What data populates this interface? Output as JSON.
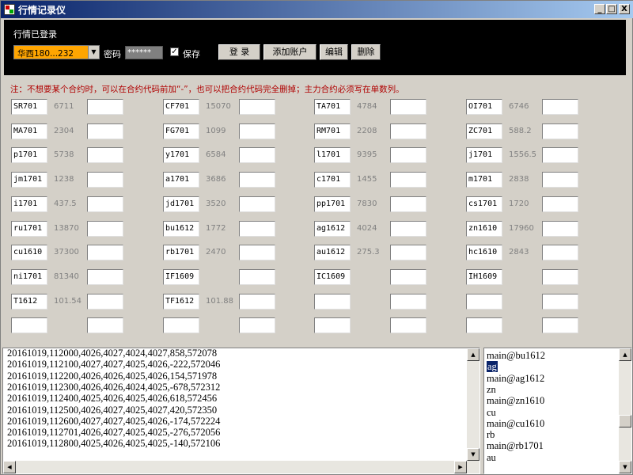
{
  "window": {
    "title": "行情记录仪",
    "controls": {
      "minimize": "_",
      "maximize": "□",
      "close": "X"
    }
  },
  "header": {
    "status": "行情已登录",
    "account": "华西180...232",
    "account_arrow": "▼",
    "password_label": "密码",
    "password_value": "******",
    "save_checked": "✓",
    "save_label": "保存",
    "login_button": "登 录",
    "add_account_button": "添加账户",
    "edit_button": "编辑",
    "delete_button": "删除"
  },
  "note": "注：不想要某个合约时，可以在合约代码前加“-”，也可以把合约代码完全删掉；主力合约必须写在单数列。",
  "contracts": [
    [
      {
        "code": "SR701",
        "price": "6711"
      },
      {
        "code": "CF701",
        "price": "15070"
      },
      {
        "code": "TA701",
        "price": "4784"
      },
      {
        "code": "OI701",
        "price": "6746"
      }
    ],
    [
      {
        "code": "MA701",
        "price": "2304"
      },
      {
        "code": "FG701",
        "price": "1099"
      },
      {
        "code": "RM701",
        "price": "2208"
      },
      {
        "code": "ZC701",
        "price": "588.2"
      }
    ],
    [
      {
        "code": "p1701",
        "price": "5738"
      },
      {
        "code": "y1701",
        "price": "6584"
      },
      {
        "code": "l1701",
        "price": "9395"
      },
      {
        "code": "j1701",
        "price": "1556.5"
      }
    ],
    [
      {
        "code": "jm1701",
        "price": "1238"
      },
      {
        "code": "a1701",
        "price": "3686"
      },
      {
        "code": "c1701",
        "price": "1455"
      },
      {
        "code": "m1701",
        "price": "2838"
      }
    ],
    [
      {
        "code": "i1701",
        "price": "437.5"
      },
      {
        "code": "jd1701",
        "price": "3520"
      },
      {
        "code": "pp1701",
        "price": "7830"
      },
      {
        "code": "cs1701",
        "price": "1720"
      }
    ],
    [
      {
        "code": "ru1701",
        "price": "13870"
      },
      {
        "code": "bu1612",
        "price": "1772"
      },
      {
        "code": "ag1612",
        "price": "4024"
      },
      {
        "code": "zn1610",
        "price": "17960"
      }
    ],
    [
      {
        "code": "cu1610",
        "price": "37300"
      },
      {
        "code": "rb1701",
        "price": "2470"
      },
      {
        "code": "au1612",
        "price": "275.3"
      },
      {
        "code": "hc1610",
        "price": "2843"
      }
    ],
    [
      {
        "code": "ni1701",
        "price": "81340"
      },
      {
        "code": "IF1609",
        "price": ""
      },
      {
        "code": "IC1609",
        "price": ""
      },
      {
        "code": "IH1609",
        "price": ""
      }
    ],
    [
      {
        "code": "T1612",
        "price": "101.54"
      },
      {
        "code": "TF1612",
        "price": "101.88"
      },
      {
        "code": "",
        "price": ""
      },
      {
        "code": "",
        "price": ""
      }
    ],
    [
      {
        "code": "",
        "price": ""
      },
      {
        "code": "",
        "price": ""
      },
      {
        "code": "",
        "price": ""
      },
      {
        "code": "",
        "price": ""
      }
    ]
  ],
  "log": [
    "20161019,112000,4026,4027,4024,4027,858,572078",
    "20161019,112100,4027,4027,4025,4026,-222,572046",
    "20161019,112200,4026,4026,4025,4026,154,571978",
    "20161019,112300,4026,4026,4024,4025,-678,572312",
    "20161019,112400,4025,4026,4025,4026,618,572456",
    "20161019,112500,4026,4027,4025,4027,420,572350",
    "20161019,112600,4027,4027,4025,4026,-174,572224",
    "20161019,112701,4026,4027,4025,4025,-276,572056",
    "20161019,112800,4025,4026,4025,4025,-140,572106"
  ],
  "side_log": [
    {
      "text": "main@bu1612",
      "selected": false
    },
    {
      "text": "ag",
      "selected": true
    },
    {
      "text": "main@ag1612",
      "selected": false
    },
    {
      "text": "zn",
      "selected": false
    },
    {
      "text": "main@zn1610",
      "selected": false
    },
    {
      "text": "cu",
      "selected": false
    },
    {
      "text": "main@cu1610",
      "selected": false
    },
    {
      "text": "rb",
      "selected": false
    },
    {
      "text": "main@rb1701",
      "selected": false
    },
    {
      "text": "au",
      "selected": false
    }
  ],
  "scroll_arrows": {
    "up": "▲",
    "down": "▼",
    "left": "◀",
    "right": "▶"
  }
}
